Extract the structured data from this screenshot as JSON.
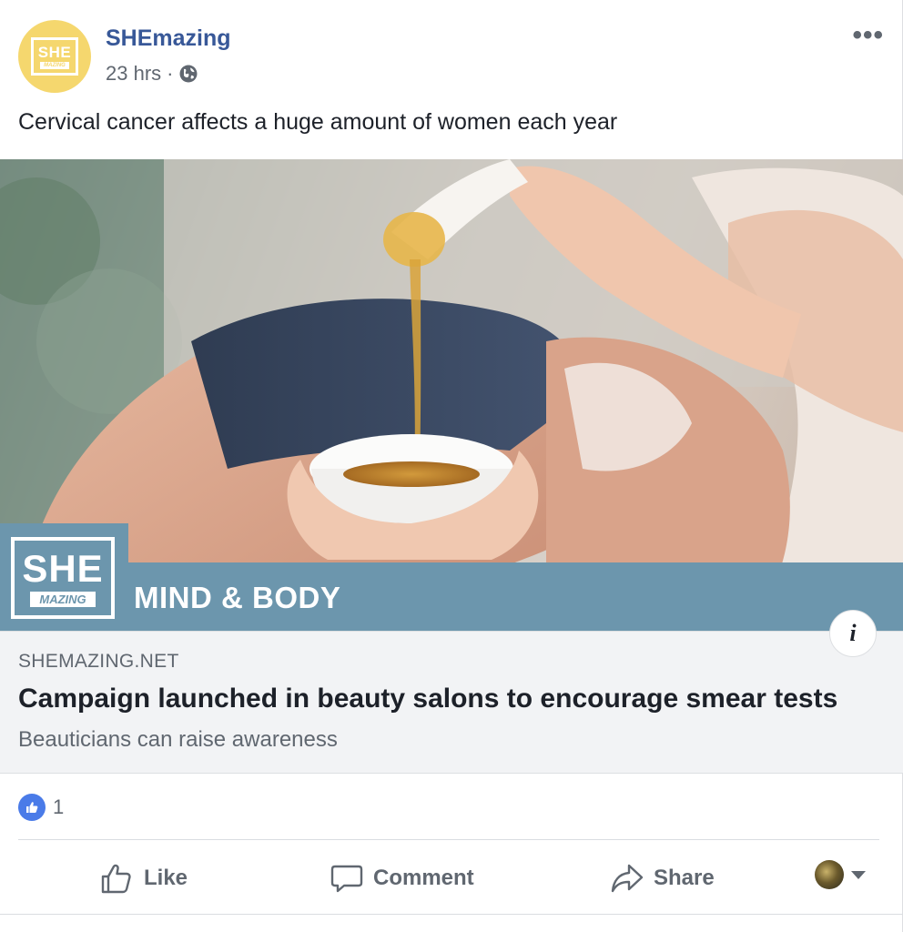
{
  "post": {
    "page_name": "SHEmazing",
    "time": "23 hrs",
    "separator": "·",
    "privacy_icon": "globe-icon",
    "more_icon": "•••",
    "text": "Cervical cancer affects a huge amount of women each year",
    "avatar": {
      "top": "SHE",
      "bottom": "MAZING"
    }
  },
  "link": {
    "brand_top": "SHE",
    "brand_bottom": "MAZING",
    "banner": "MIND & BODY",
    "info": "i",
    "domain": "SHEMAZING.NET",
    "title": "Campaign launched in beauty salons to encourage smear tests",
    "description": "Beauticians can raise awareness"
  },
  "reactions": {
    "icon": "like-reaction-icon",
    "count": "1"
  },
  "actions": {
    "like": "Like",
    "comment": "Comment",
    "share": "Share"
  },
  "colors": {
    "name_link": "#385898",
    "brand_blue": "#6c96ad",
    "avatar_yellow": "#f5d76e",
    "like_blue": "#4a7be8"
  }
}
